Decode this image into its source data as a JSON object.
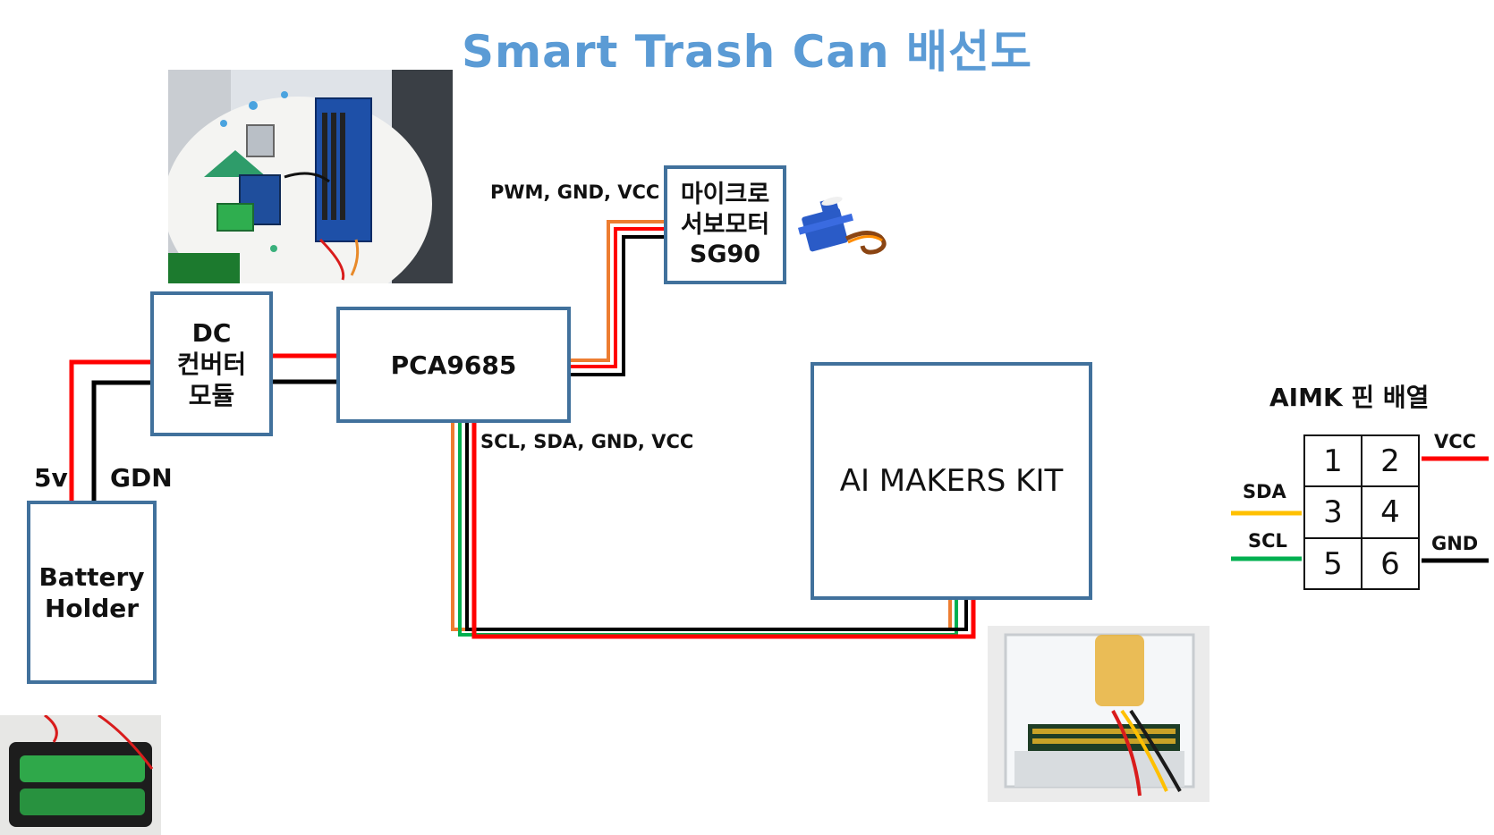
{
  "title": "Smart Trash Can 배선도",
  "blocks": {
    "battery": [
      "Battery",
      "Holder"
    ],
    "dc": [
      "DC",
      "컨버터",
      "모듈"
    ],
    "pca": "PCA9685",
    "servo": [
      "마이크로",
      "서보모터",
      "SG90"
    ],
    "ai": "AI MAKERS KIT"
  },
  "labels": {
    "power_pos": "5v",
    "power_gnd": "GDN",
    "servo_bus": "PWM, GND, VCC",
    "i2c_bus": "SCL, SDA, GND, VCC"
  },
  "pinout": {
    "title": "AIMK 핀 배열",
    "pins": [
      "1",
      "2",
      "3",
      "4",
      "5",
      "6"
    ],
    "signals": {
      "vcc": "VCC",
      "sda": "SDA",
      "scl": "SCL",
      "gnd": "GND"
    }
  },
  "photos": {
    "dc_pca_board": "photo of DC module and PCA9685 on cup",
    "battery_pack": "photo of battery holder",
    "servo": "SG90 servo",
    "kit_board": "photo of AI makers kit board"
  },
  "colors": {
    "title": "#5b9bd5",
    "box_border": "#41719c",
    "wire_red": "#ff0000",
    "wire_black": "#000000",
    "wire_orange": "#ed7d31",
    "wire_green": "#00b050",
    "wire_yellow": "#ffc000"
  }
}
